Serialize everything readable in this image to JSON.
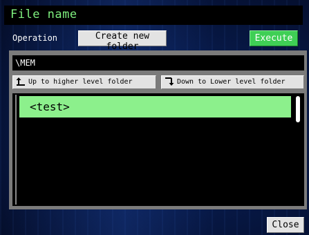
{
  "header": {
    "title": "File name"
  },
  "toolbar": {
    "operation_label": "Operation",
    "operation_value": "Create new folder",
    "execute_label": "Execute"
  },
  "path": {
    "current": "\\MEM"
  },
  "navigation": {
    "up_label": "Up to higher level folder",
    "down_label": "Down to Lower level folder"
  },
  "file_list": {
    "items": [
      {
        "label": "<test>",
        "selected": true
      }
    ]
  },
  "footer": {
    "close_label": "Close"
  },
  "colors": {
    "title_text": "#7ff07f",
    "selection": "#8cf08c",
    "execute_button": "#3fcf55",
    "panel": "#7b7b7b",
    "button_face": "#e3e3e3",
    "background": "#071845"
  },
  "icons": {
    "up": "arrow-up-left-icon",
    "down": "arrow-down-right-icon"
  }
}
